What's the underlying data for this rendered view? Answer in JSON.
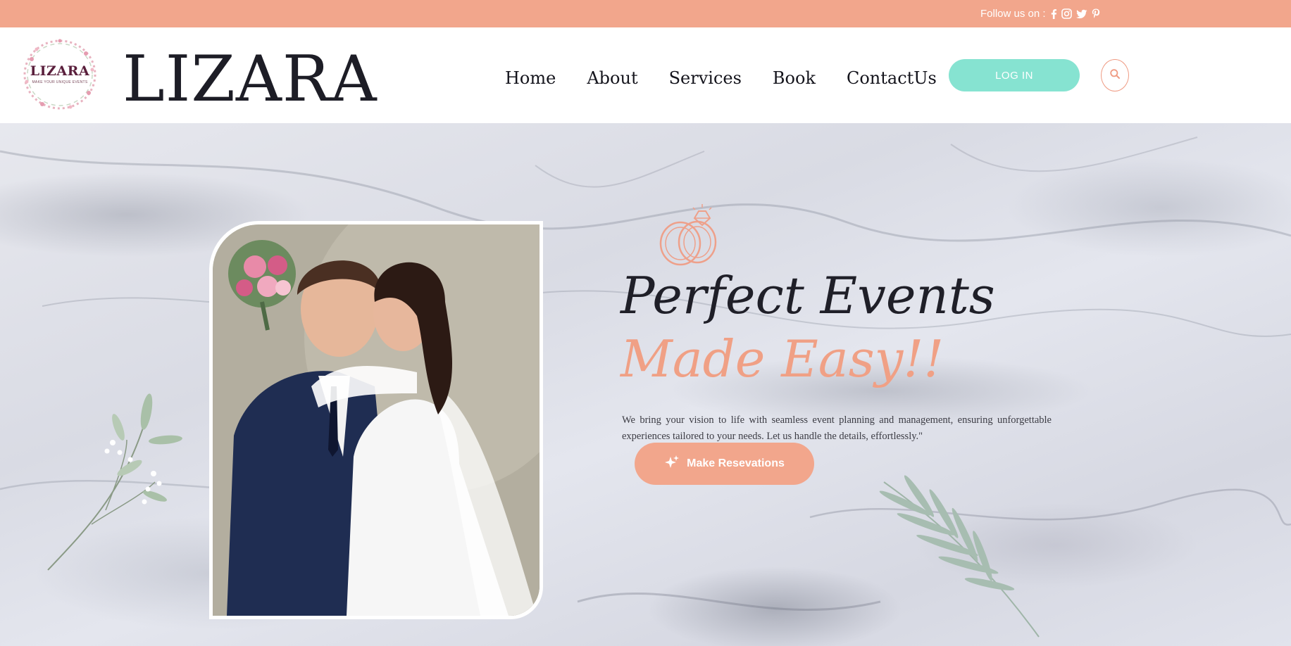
{
  "topbar": {
    "follow_label": "Follow us on :",
    "social": [
      "facebook-icon",
      "instagram-icon",
      "twitter-icon",
      "pinterest-icon"
    ]
  },
  "header": {
    "logo_text": "LIZARA",
    "logo_tagline": "MAKE YOUR UNIQUE EVENTS",
    "brand": "LIZARA",
    "nav": [
      "Home",
      "About",
      "Services",
      "Book",
      "ContactUs"
    ],
    "login_label": "LOG IN",
    "search_icon": "search-icon"
  },
  "hero": {
    "headline_line1": "Perfect Events",
    "headline_line2": "Made Easy!!",
    "description": "We bring your vision to life with seamless event planning and management, ensuring unforgettable experiences tailored to your needs. Let us handle the details, effortlessly.\"",
    "cta_label": "Make Resevations",
    "cta_icon": "sparkle-icon"
  },
  "colors": {
    "accent": "#f2a68c",
    "teal": "#86e3d1",
    "dark": "#1f1f28"
  }
}
